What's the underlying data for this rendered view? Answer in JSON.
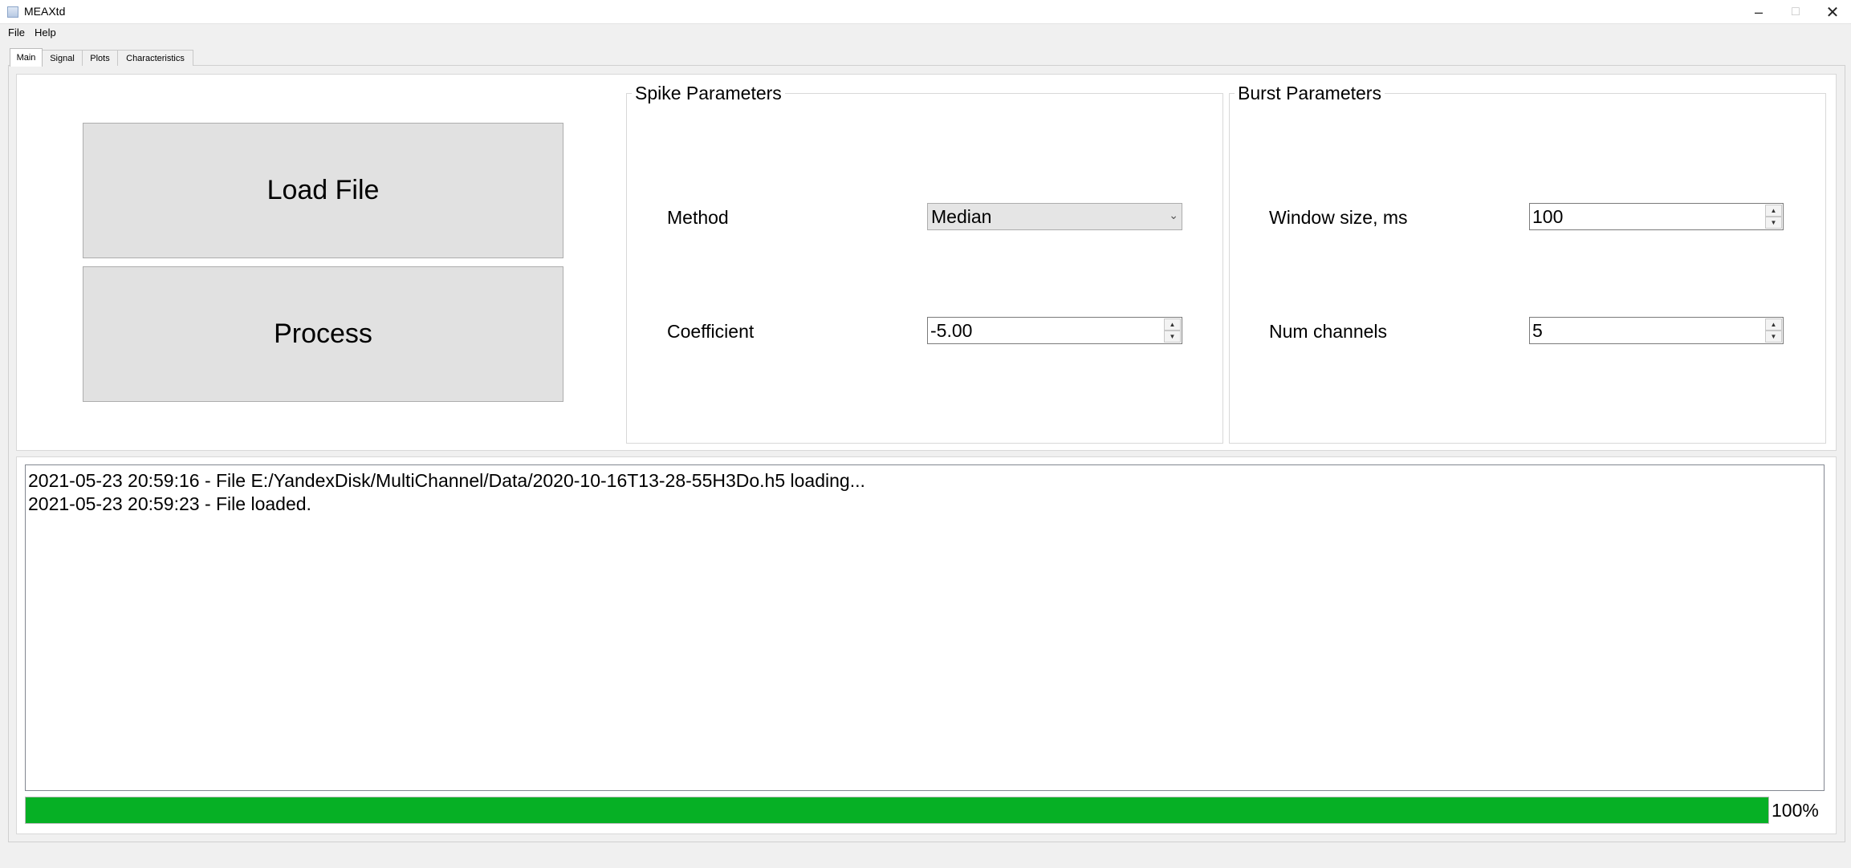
{
  "window": {
    "title": "MEAXtd"
  },
  "menu": {
    "items": [
      "File",
      "Help"
    ]
  },
  "tabs": [
    "Main",
    "Signal",
    "Plots",
    "Characteristics"
  ],
  "main": {
    "load_button": "Load File",
    "process_button": "Process"
  },
  "spike": {
    "title": "Spike Parameters",
    "method_label": "Method",
    "method_value": "Median",
    "coefficient_label": "Coefficient",
    "coefficient_value": "-5.00"
  },
  "burst": {
    "title": "Burst Parameters",
    "window_label": "Window size, ms",
    "window_value": "100",
    "channels_label": "Num channels",
    "channels_value": "5"
  },
  "log": {
    "lines": [
      "2021-05-23 20:59:16 - File E:/YandexDisk/MultiChannel/Data/2020-10-16T13-28-55H3Do.h5 loading...",
      "2021-05-23 20:59:23 - File loaded."
    ]
  },
  "progress": {
    "value": 100,
    "label": "100%",
    "color": "#06b025"
  }
}
